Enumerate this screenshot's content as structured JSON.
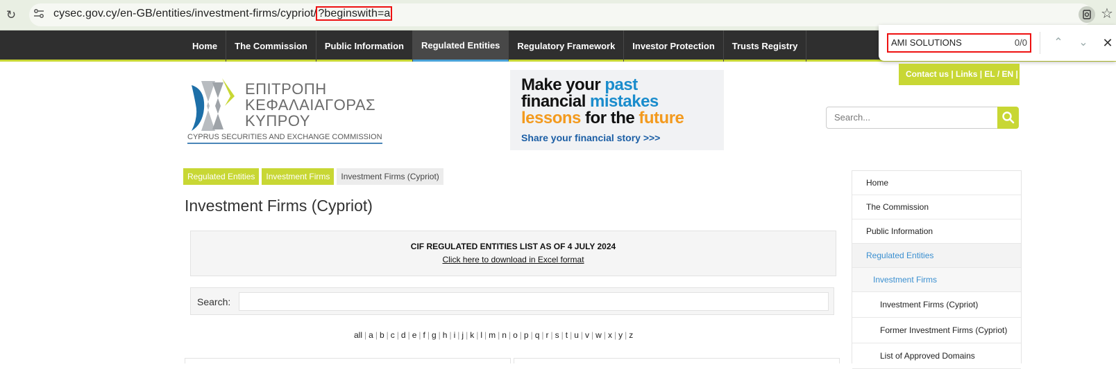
{
  "browser": {
    "url_prefix": "cysec.gov.cy/en-GB/entities/investment-firms/cypriot/",
    "url_query": "?beginswith=a",
    "find_query": "AMI SOLUTIONS",
    "find_count": "0/0"
  },
  "nav": {
    "items": [
      "Home",
      "The Commission",
      "Public Information",
      "Regulated Entities",
      "Regulatory Framework",
      "Investor Protection",
      "Trusts Registry"
    ],
    "active_index": 3
  },
  "header": {
    "contact_links": "Contact us  |  Links  |   EL / EN |",
    "logo_greek": "ΕΠΙΤΡΟΠΗ\nΚΕΦΑΛΑΙΑΓΟΡΑΣ\nΚΥΠΡΟΥ",
    "logo_english": "CYPRUS SECURITIES AND EXCHANGE COMMISSION",
    "banner": {
      "line1_a": "Make your ",
      "line1_b": "past",
      "line2_a": "financial ",
      "line2_b": "mistakes",
      "line3_a": "lessons",
      "line3_b": " for the ",
      "line3_c": "future",
      "cta": "Share your financial story >>>"
    },
    "search_placeholder": "Search..."
  },
  "breadcrumb": [
    "Regulated Entities",
    "Investment Firms",
    "Investment Firms (Cypriot)"
  ],
  "page_title": "Investment Firms (Cypriot)",
  "cif": {
    "title": "CIF REGULATED ENTITIES LIST AS OF 4 JULY 2024",
    "link": "Click here to download in Excel format"
  },
  "search_label": "Search:",
  "alphabet": [
    "all",
    "a",
    "b",
    "c",
    "d",
    "e",
    "f",
    "g",
    "h",
    "i",
    "j",
    "k",
    "l",
    "m",
    "n",
    "o",
    "p",
    "q",
    "r",
    "s",
    "t",
    "u",
    "v",
    "w",
    "x",
    "y",
    "z"
  ],
  "sidebar": {
    "items": [
      {
        "label": "Home",
        "level": 1
      },
      {
        "label": "The Commission",
        "level": 1
      },
      {
        "label": "Public Information",
        "level": 1
      },
      {
        "label": "Regulated Entities",
        "level": 1,
        "active": true
      },
      {
        "label": "Investment Firms",
        "level": 2,
        "active": true
      },
      {
        "label": "Investment Firms (Cypriot)",
        "level": 3
      },
      {
        "label": "Former Investment Firms (Cypriot)",
        "level": 3
      },
      {
        "label": "List of Approved Domains",
        "level": 3
      }
    ]
  },
  "colors": {
    "accent_green": "#c8d734",
    "nav_dark": "#2f2f2f",
    "link_blue": "#3a8fd0",
    "banner_blue": "#1a8ccc",
    "banner_orange": "#f39a1e",
    "find_highlight": "#e11111"
  }
}
